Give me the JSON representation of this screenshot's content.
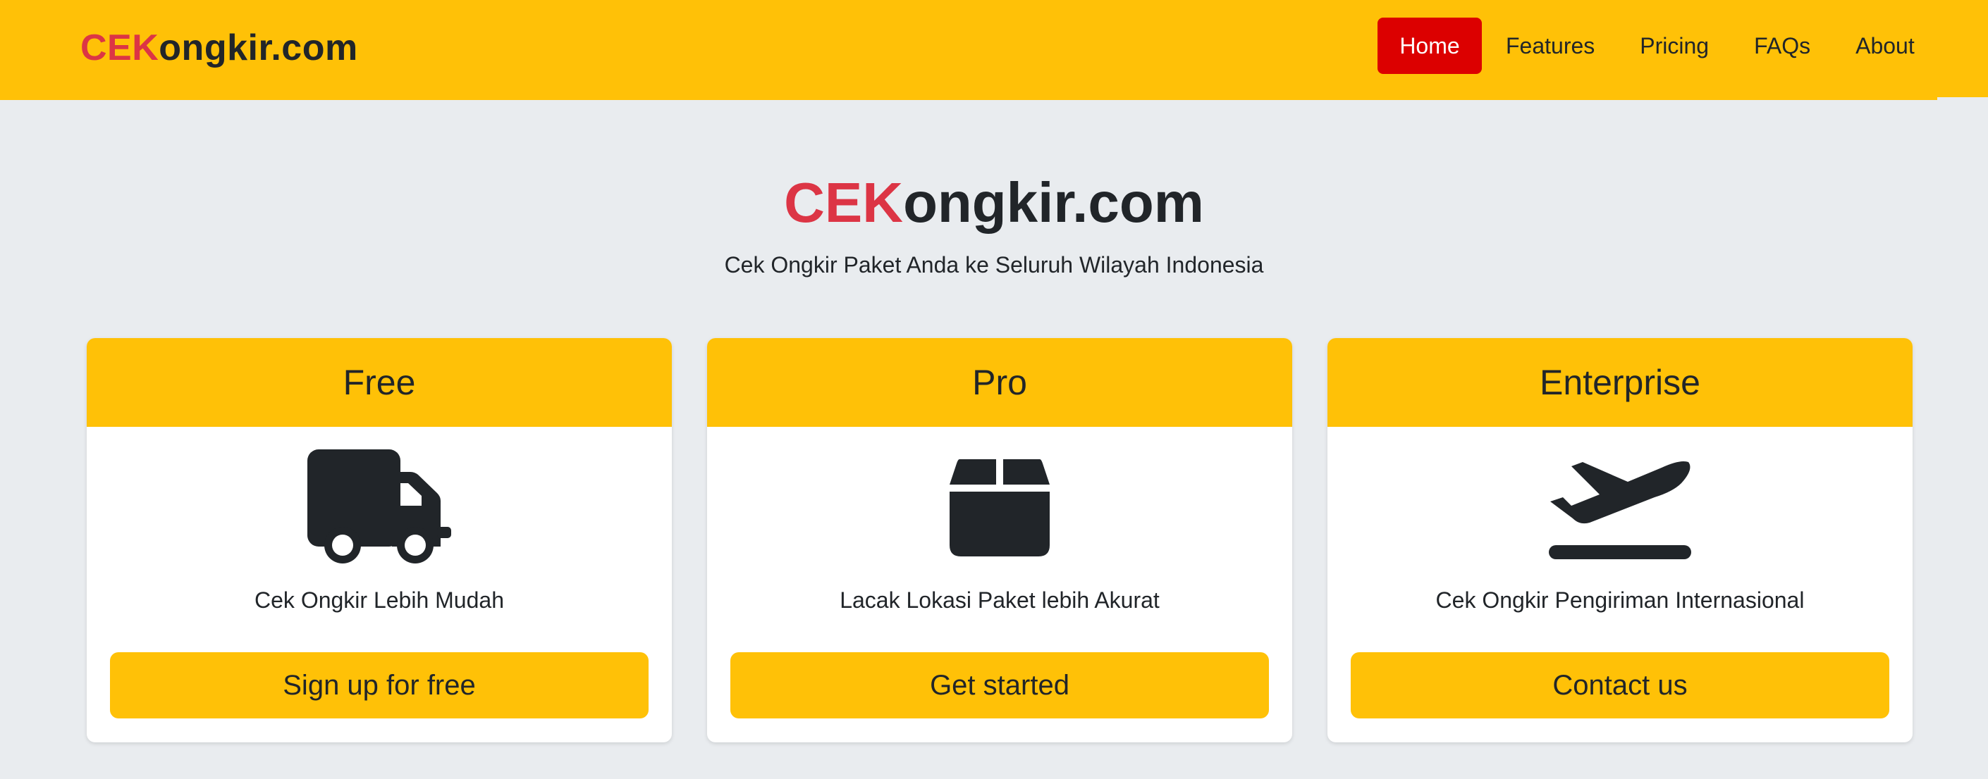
{
  "navbar": {
    "brand_accent": "CEK",
    "brand_rest": "ongkir.com",
    "items": [
      {
        "label": "Home"
      },
      {
        "label": "Features"
      },
      {
        "label": "Pricing"
      },
      {
        "label": "FAQs"
      },
      {
        "label": "About"
      }
    ],
    "active_item": "Home"
  },
  "hero": {
    "title_accent": "CEK",
    "title_rest": "ongkir.com",
    "subtitle": "Cek Ongkir Paket Anda ke Seluruh Wilayah Indonesia"
  },
  "cards": [
    {
      "title": "Free",
      "icon": "truck-icon",
      "description": "Cek Ongkir Lebih Mudah",
      "button_label": "Sign up for free"
    },
    {
      "title": "Pro",
      "icon": "box-icon",
      "description": "Lacak Lokasi Paket lebih Akurat",
      "button_label": "Get started"
    },
    {
      "title": "Enterprise",
      "icon": "airplane-departure-icon",
      "description": "Cek Ongkir Pengiriman Internasional",
      "button_label": "Contact us"
    }
  ],
  "colors": {
    "primary_yellow": "#ffc107",
    "brand_red": "#dc3545",
    "active_nav_red": "#dc0000",
    "background": "#e9ecef",
    "text_dark": "#212529"
  }
}
